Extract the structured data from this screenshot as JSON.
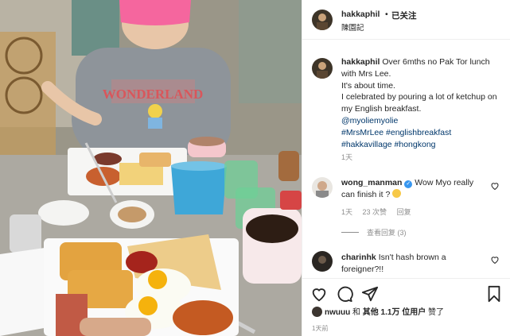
{
  "photo": {
    "shirt_text": "WONDERLAND"
  },
  "header": {
    "username": "hakkaphil",
    "separator": "•",
    "follow_status": "已关注",
    "location": "陳園記"
  },
  "caption": {
    "username": "hakkaphil",
    "lines": [
      "Over 6mths no Pak Tor lunch with Mrs Lee.",
      "It's about time.",
      "I celebrated by pouring a lot of ketchup on my English breakfast."
    ],
    "mention": "@myoliemyolie",
    "hashtags_line1": "#MrsMrLee #englishbreakfast",
    "hashtags_line2": "#hakkavillage #hongkong",
    "time": "1天"
  },
  "comments": [
    {
      "username": "wong_manman",
      "verified": true,
      "text": "Wow Myo really can finish it ?",
      "time": "1天",
      "likes": "23 次赞",
      "reply": "回复"
    },
    {
      "username": "charinhk",
      "text": "Isn't hash brown a foreigner?!!"
    }
  ],
  "view_replies": "查看回复 (3)",
  "actions": {
    "icons": [
      "heart-icon",
      "comment-icon",
      "share-icon",
      "bookmark-icon"
    ]
  },
  "likes": {
    "liker": "nwuuu",
    "and": "和",
    "others": "其他 1.1万 位用户",
    "suffix": "赞了"
  },
  "post_time": "1天前",
  "colors": {
    "link": "#00376b",
    "secondary": "#8e8e8e",
    "verified": "#3897f0",
    "hat": "#f5669e"
  }
}
